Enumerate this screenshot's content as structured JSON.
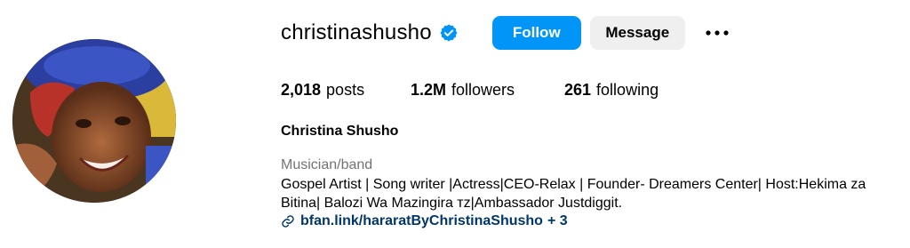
{
  "profile": {
    "username": "christinashusho",
    "verified_icon": "verified-badge-icon",
    "full_name": "Christina Shusho",
    "category": "Musician/band",
    "bio_lines": [
      "Gospel Artist | Song writer |Actress|CEO-Relax | Founder- Dreamers Center| Host:Hekima za",
      "Bitina| Balozi Wa Mazingira ᴛᴢ|Ambassador Justdiggit."
    ],
    "link": {
      "icon": "link-icon",
      "text": "bfan.link/hararatByChristinaShusho",
      "extra": "+ 3"
    }
  },
  "actions": {
    "follow_label": "Follow",
    "message_label": "Message",
    "more_icon": "more-options-icon"
  },
  "stats": {
    "posts_count": "2,018",
    "posts_label": "posts",
    "followers_count": "1.2M",
    "followers_label": "followers",
    "following_count": "261",
    "following_label": "following"
  },
  "colors": {
    "accent": "#0095f6",
    "secondary_button": "#efefef",
    "muted_text": "#737373",
    "link_text": "#00376b"
  }
}
